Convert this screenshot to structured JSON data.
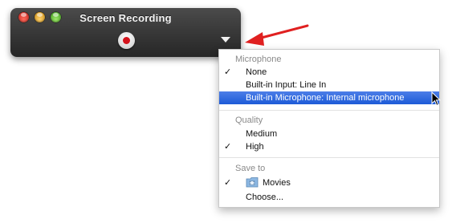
{
  "window": {
    "title": "Screen Recording",
    "record_icon": "record-icon",
    "menu_trigger_icon": "triangle-down-icon"
  },
  "annotation": {
    "arrow_color": "#e02020"
  },
  "menu": {
    "sections": [
      {
        "heading": "Microphone",
        "items": [
          {
            "label": "None",
            "checked": true,
            "selected": false
          },
          {
            "label": "Built-in Input: Line In",
            "checked": false,
            "selected": false
          },
          {
            "label": "Built-in Microphone: Internal microphone",
            "checked": false,
            "selected": true
          }
        ]
      },
      {
        "heading": "Quality",
        "items": [
          {
            "label": "Medium",
            "checked": false,
            "selected": false
          },
          {
            "label": "High",
            "checked": true,
            "selected": false
          }
        ]
      },
      {
        "heading": "Save to",
        "items": [
          {
            "label": "Movies",
            "checked": true,
            "selected": false,
            "icon": "folder-icon"
          },
          {
            "label": "Choose...",
            "checked": false,
            "selected": false
          }
        ]
      }
    ],
    "check_glyph": "✓",
    "highlight_color": "#2a64dc"
  }
}
